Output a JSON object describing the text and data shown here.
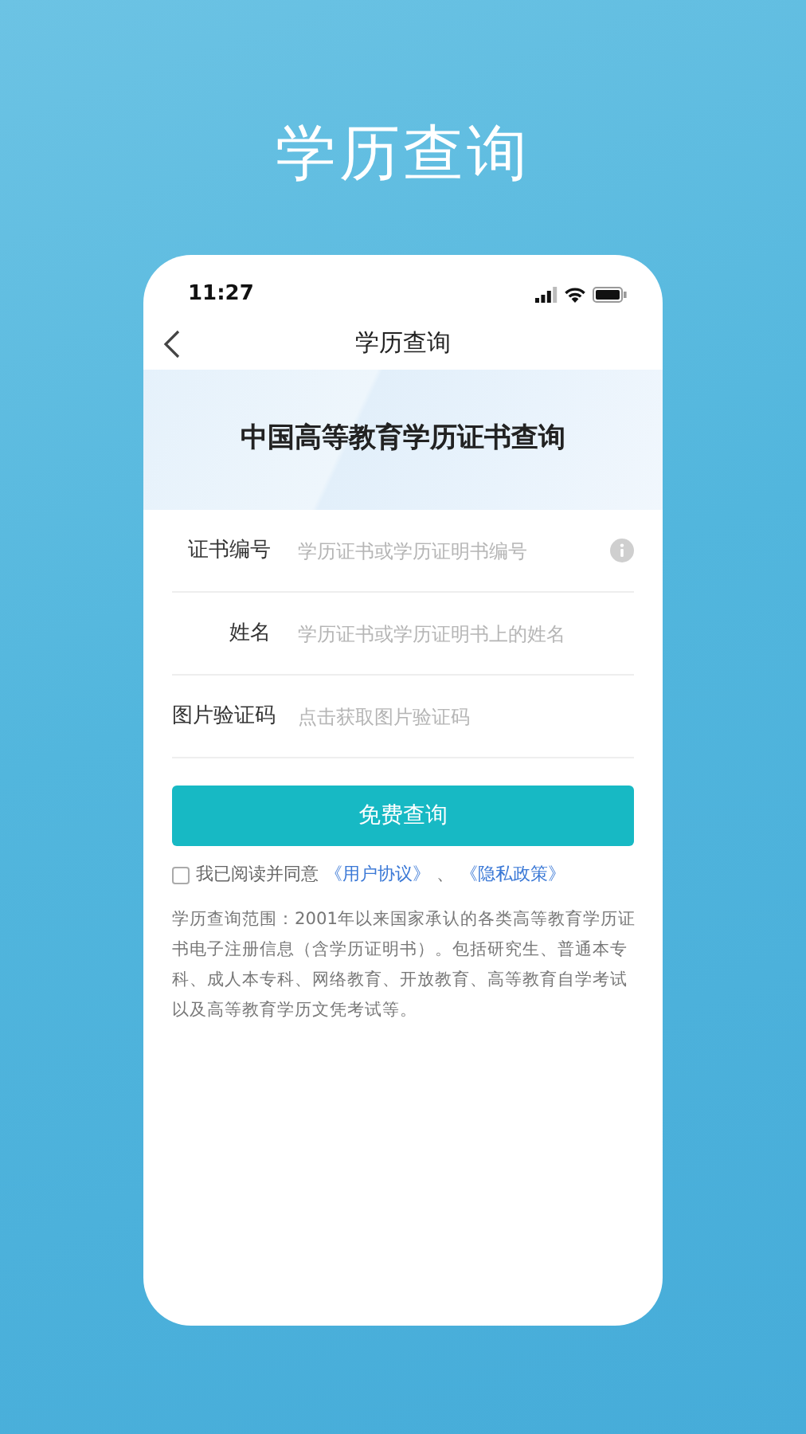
{
  "headline": "学历查询",
  "status_bar": {
    "time": "11:27"
  },
  "nav": {
    "title": "学历查询"
  },
  "banner": {
    "title": "中国高等教育学历证书查询"
  },
  "fields": [
    {
      "label": "证书编号",
      "placeholder": "学历证书或学历证明书编号",
      "info": true
    },
    {
      "label": "姓名",
      "placeholder": "学历证书或学历证明书上的姓名",
      "info": false
    },
    {
      "label": "图片验证码",
      "placeholder": "点击获取图片验证码",
      "info": false
    }
  ],
  "submit": "免费查询",
  "agreement": {
    "checked": false,
    "text": "我已阅读并同意",
    "links": [
      "《用户协议》",
      "《隐私政策》"
    ],
    "separator": "、"
  },
  "description": "学历查询范围：2001年以来国家承认的各类高等教育学历证书电子注册信息（含学历证明书）。包括研究生、普通本专科、成人本专科、网络教育、开放教育、高等教育自学考试以及高等教育学历文凭考试等。"
}
